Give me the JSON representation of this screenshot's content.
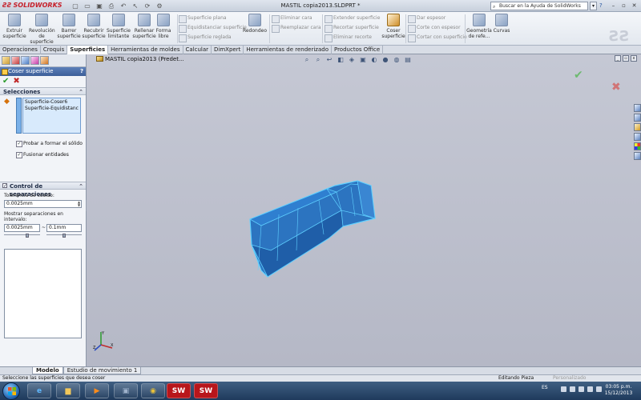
{
  "app": {
    "logo_text": "SOLIDWORKS",
    "doc_title": "MASTIL copia2013.SLDPRT *",
    "search_placeholder": "Buscar en la Ayuda de SolidWorks",
    "help_label": "?"
  },
  "ribbon": {
    "big_buttons": [
      {
        "label": "Extruir superficie"
      },
      {
        "label": "Revolución de superficie"
      },
      {
        "label": "Barrer superficie"
      },
      {
        "label": "Recubrir superficie"
      },
      {
        "label": "Superficie limitante"
      },
      {
        "label": "Rellenar superficie"
      },
      {
        "label": "Forma libre"
      },
      {
        "label": "Redondeo"
      },
      {
        "label": "Coser superficie"
      },
      {
        "label": "Geometría de refe..."
      },
      {
        "label": "Curvas"
      }
    ],
    "small_buttons": {
      "superficie_plana": "Superficie plana",
      "equidistanciar": "Equidistanciar superficie",
      "reglada": "Superficie reglada",
      "eliminar_cara": "Eliminar cara",
      "reemplazar_cara": "Reemplazar cara",
      "extender": "Extender superficie",
      "recortar": "Recortar superficie",
      "eliminar_recorte": "Eliminar recorte",
      "dar_espesor": "Dar espesor",
      "corte_espesor": "Corte con espesor",
      "cortar_superficie": "Cortar con superficie"
    }
  },
  "tabs": [
    {
      "label": "Operaciones",
      "active": false
    },
    {
      "label": "Croquis",
      "active": false
    },
    {
      "label": "Superficies",
      "active": true
    },
    {
      "label": "Herramientas de moldes",
      "active": false
    },
    {
      "label": "Calcular",
      "active": false
    },
    {
      "label": "DimXpert",
      "active": false
    },
    {
      "label": "Herramientas de renderizado",
      "active": false
    },
    {
      "label": "Productos Office",
      "active": false
    }
  ],
  "property_manager": {
    "title": "Coser superficie",
    "help": "?",
    "selections": {
      "header": "Selecciones",
      "items": [
        "Superficie-Coser6",
        "Superficie-Equidistancia1"
      ],
      "try_solid": "Probar a formar el sólido",
      "merge": "Fusionar entidades"
    },
    "gap_control": {
      "header": "Control de separaciones",
      "tolerance_label": "Tolerancia de cosido:",
      "tolerance_value": "0.0025mm",
      "range_label": "Mostrar separaciones en intervalo:",
      "range_min": "0.0025mm",
      "range_max": "0.1mm",
      "range_sep": "~"
    }
  },
  "graphics": {
    "tree_root": "MASTIL copia2013  (Predet..."
  },
  "model_tabs": [
    {
      "label": "Modelo",
      "active": true
    },
    {
      "label": "Estudio de movimiento 1",
      "active": false
    }
  ],
  "status": {
    "message": "Seleccione las superficies que desea coser",
    "mode": "Editando Pieza",
    "custom": "Personalizado"
  },
  "taskbar": {
    "lang": "ES",
    "time": "03:05 p.m.",
    "date": "15/12/2013",
    "sw_label": "SW"
  },
  "colors": {
    "model_fill": "#2f78c4",
    "model_edge": "#55c8ff",
    "pm_header": "#4a6ea8"
  }
}
